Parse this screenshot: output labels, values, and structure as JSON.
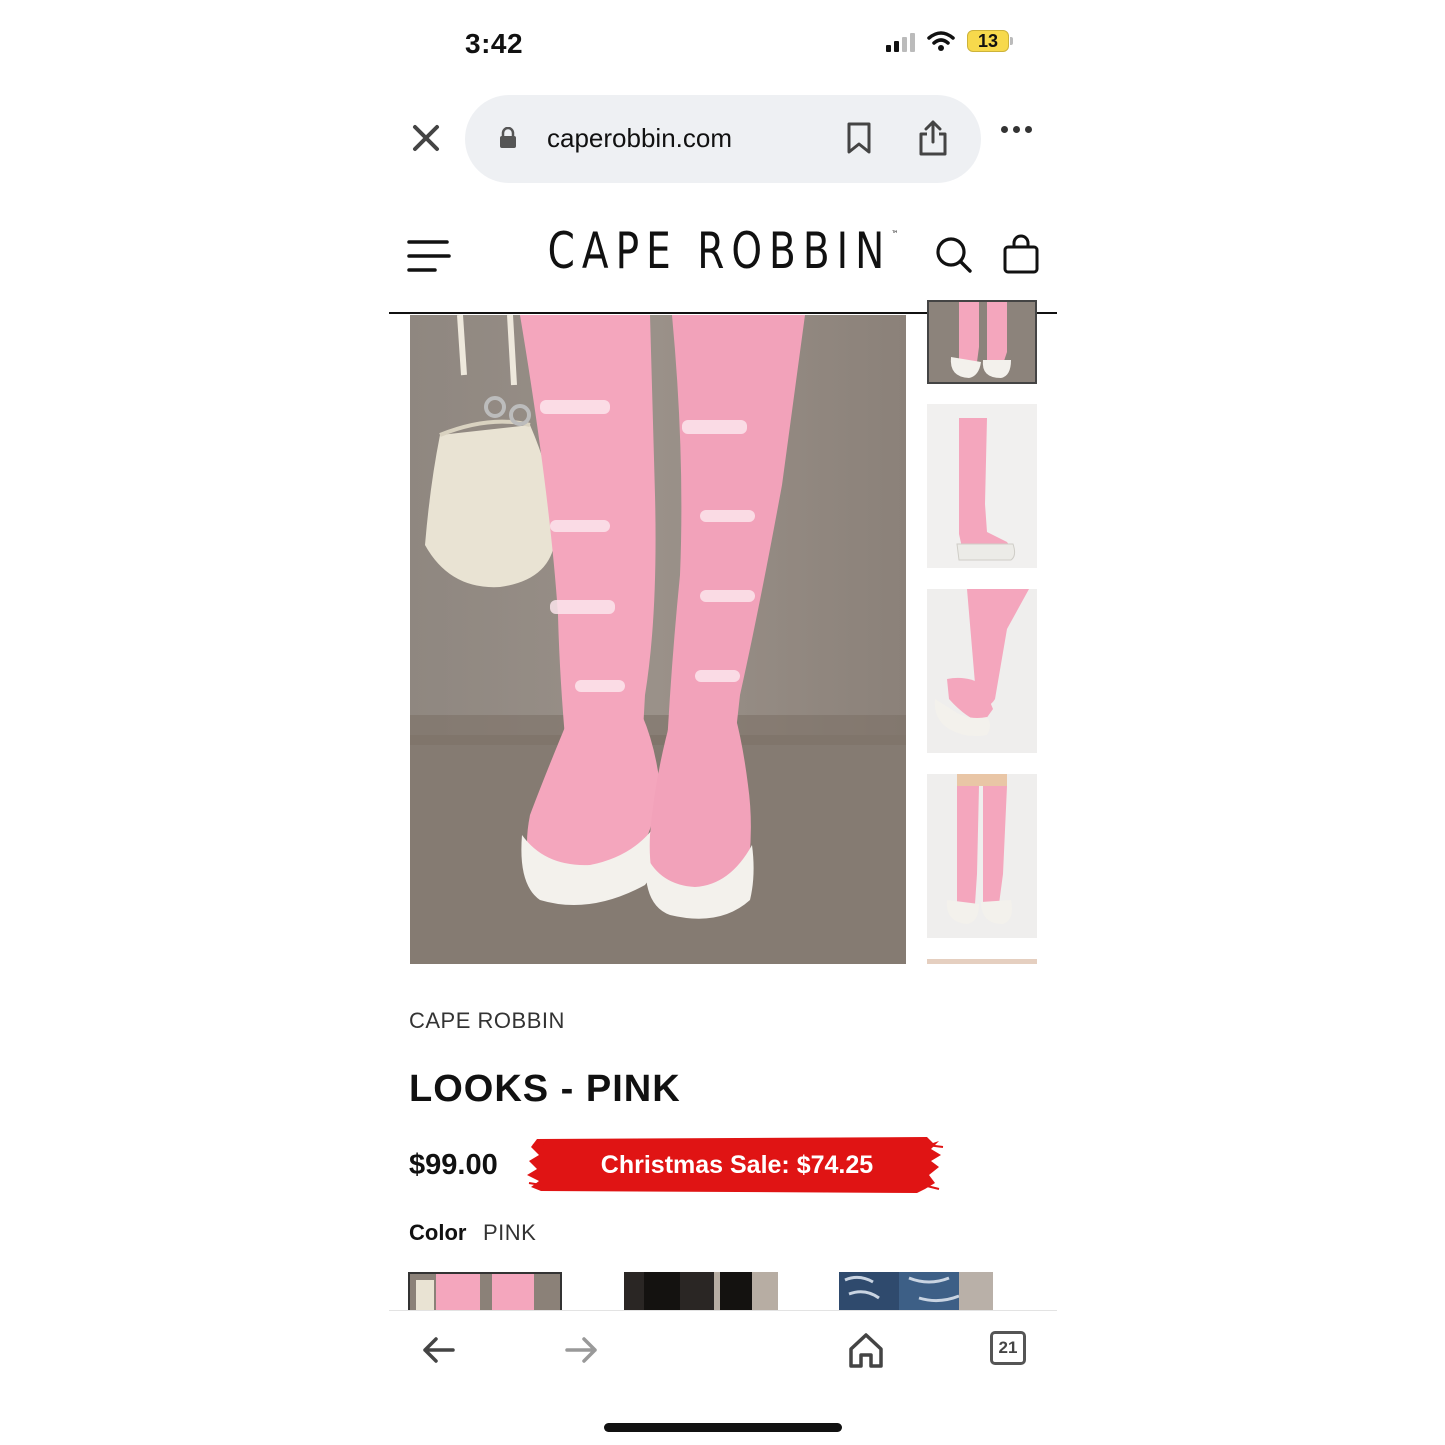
{
  "status_bar": {
    "time": "3:42",
    "battery": "13"
  },
  "browser": {
    "url": "caperobbin.com",
    "tab_count": "21"
  },
  "site": {
    "brand": "CAPE ROBBIN",
    "trademark": "™"
  },
  "product": {
    "vendor": "CAPE ROBBIN",
    "title": "LOOKS - PINK",
    "price": "$99.00",
    "sale_label": "Christmas Sale: $74.25",
    "color_label": "Color",
    "color_value": "PINK"
  },
  "colors": {
    "sale_red": "#e01414",
    "boot_pink": "#f4a6bd",
    "sole_white": "#f3f1ec"
  },
  "icons": [
    "close-icon",
    "lock-icon",
    "bookmark-icon",
    "share-icon",
    "more-icon",
    "menu-icon",
    "search-icon",
    "bag-icon",
    "back-icon",
    "forward-icon",
    "home-icon",
    "tabs-icon"
  ]
}
